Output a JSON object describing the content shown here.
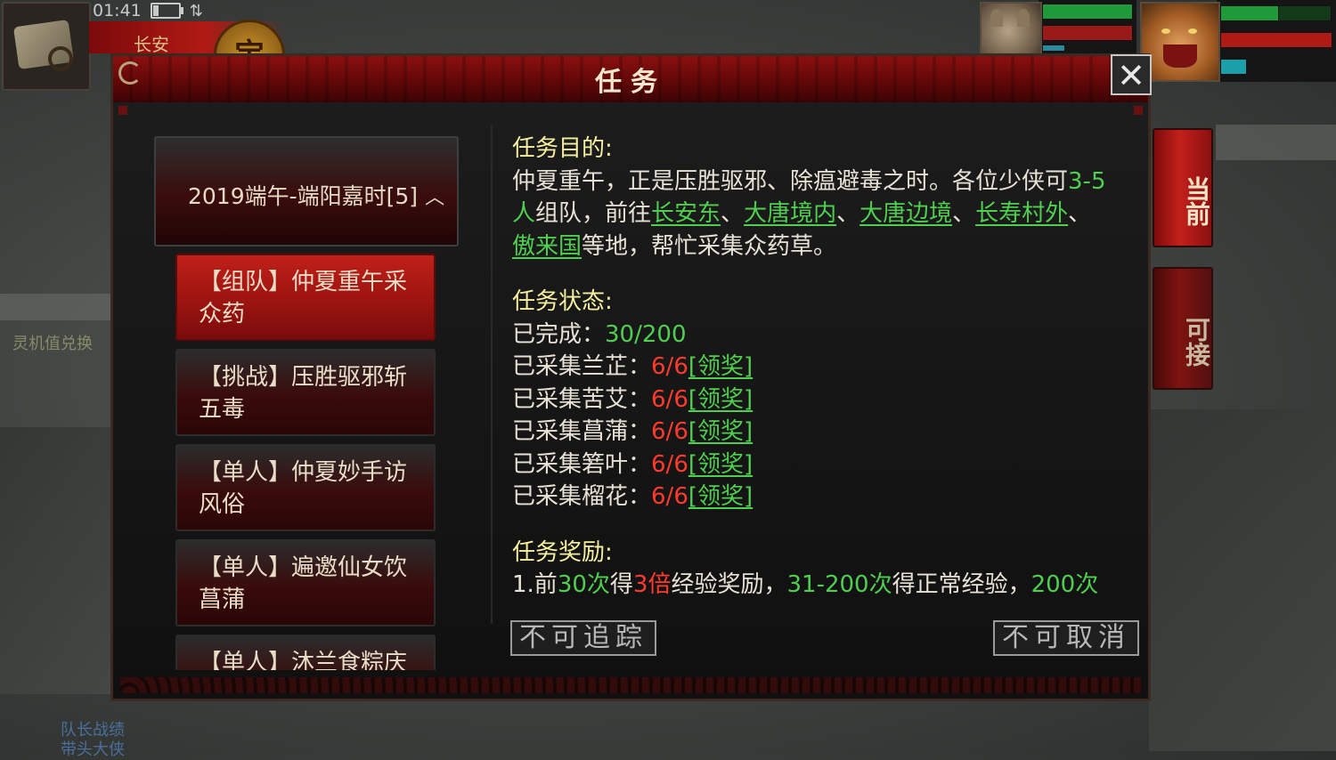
{
  "status": {
    "time": "01:41"
  },
  "hud": {
    "city": "长安",
    "city_seal": "宝",
    "left_label": "灵机值兑换",
    "bottom_label_1": "队长战绩",
    "bottom_label_2": "带头大侠"
  },
  "side_tabs": {
    "current": "当前",
    "available": "可接"
  },
  "dialog": {
    "title": "任务",
    "close_icon": "close-icon",
    "category": "2019端午-端阳嘉时[5]",
    "tasks": [
      {
        "line1": "【组队】仲夏重午采",
        "line2": "众药",
        "active": true
      },
      {
        "line1": "【挑战】压胜驱邪斩",
        "line2": "五毒",
        "active": false
      },
      {
        "line1": "【单人】仲夏妙手访",
        "line2": "风俗",
        "active": false
      },
      {
        "line1": "【单人】遍邀仙女饮",
        "line2": "菖蒲",
        "active": false
      },
      {
        "line1": "【单人】沐兰食粽庆",
        "line2": "",
        "active": false
      }
    ],
    "objective": {
      "title": "任务目的:",
      "text_1": "仲夏重午，正是压胜驱邪、除瘟避毒之时。各位少侠可",
      "team_size": "3-5人",
      "text_2": "组队，前往",
      "places": [
        "长安东",
        "大唐境内",
        "大唐边境",
        "长寿村外",
        "傲来国"
      ],
      "sep": "、",
      "text_3": "等地，帮忙采集众药草。"
    },
    "status": {
      "title": "任务状态:",
      "completed_label": "已完成：",
      "completed_value": "30/200",
      "herbs": [
        {
          "label": "已采集兰芷：",
          "value": "6/6",
          "claim": "[领奖]"
        },
        {
          "label": "已采集苦艾：",
          "value": "6/6",
          "claim": "[领奖]"
        },
        {
          "label": "已采集菖蒲：",
          "value": "6/6",
          "claim": "[领奖]"
        },
        {
          "label": "已采集箬叶：",
          "value": "6/6",
          "claim": "[领奖]"
        },
        {
          "label": "已采集榴花：",
          "value": "6/6",
          "claim": "[领奖]"
        }
      ]
    },
    "reward": {
      "title": "任务奖励:",
      "p1": "1.前",
      "n1": "30次",
      "p2": "得",
      "n2": "3倍",
      "p3": "经验奖励，",
      "n3": "31-200次",
      "p4": "得正常经验，",
      "n4": "200次"
    },
    "buttons": {
      "untrackable": "不可追踪",
      "uncancelable": "不可取消"
    }
  },
  "colors": {
    "accent_red": "#b11a14",
    "highlight_green": "#4fce4f",
    "title_yellow": "#f6f0a0",
    "count_red": "#ff3b2e"
  }
}
